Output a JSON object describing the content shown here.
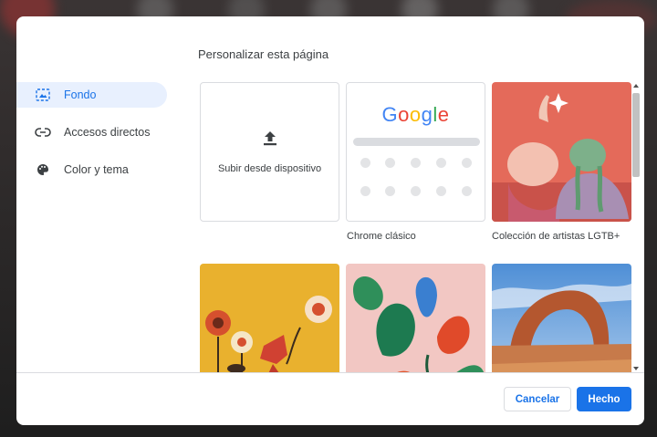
{
  "dialog": {
    "title": "Personalizar esta página"
  },
  "sidebar": {
    "items": [
      {
        "label": "Fondo",
        "icon": "background-icon",
        "active": true
      },
      {
        "label": "Accesos directos",
        "icon": "link-icon",
        "active": false
      },
      {
        "label": "Color y tema",
        "icon": "palette-icon",
        "active": false
      }
    ]
  },
  "tiles": {
    "upload": {
      "label": "Subir desde dispositivo",
      "icon": "upload-icon"
    },
    "classic": {
      "logo": "Google",
      "caption": "Chrome clásico"
    },
    "lgbt": {
      "caption": "Colección de artistas LGTB+"
    }
  },
  "footer": {
    "cancel_label": "Cancelar",
    "done_label": "Hecho"
  },
  "colors": {
    "accent": "#1a73e8",
    "active_bg": "#e8f0fe"
  }
}
